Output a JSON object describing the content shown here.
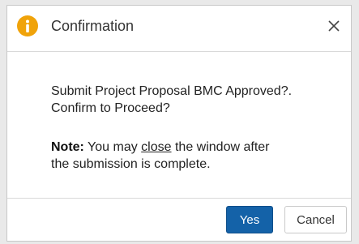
{
  "dialog": {
    "title": "Confirmation",
    "icon": "info-icon",
    "close_symbol": "×",
    "message_line1": "Submit Project Proposal BMC Approved?.",
    "message_line2": "Confirm to Proceed?",
    "note_label": "Note:",
    "note_pre": " You may ",
    "note_link": "close",
    "note_post": " the window after",
    "note_line2": "the submission is complete.",
    "buttons": {
      "yes": "Yes",
      "cancel": "Cancel"
    }
  },
  "colors": {
    "accent": "#1462a8",
    "icon": "#f0a30a"
  }
}
